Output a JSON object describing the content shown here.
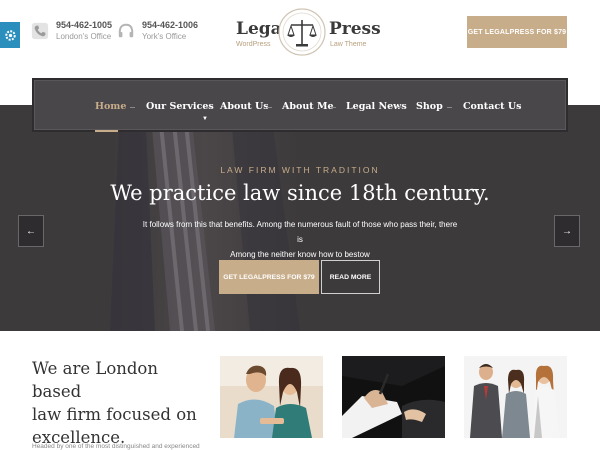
{
  "colors": {
    "accent": "#c8ad8b",
    "hero_bg": "#3d3a3c",
    "nav_bg": "#4a474b",
    "settings_tab": "#2a8fbd"
  },
  "settings": {
    "icon": "gear-icon"
  },
  "contacts": [
    {
      "icon": "phone-icon",
      "number": "954-462-1005",
      "label": "London's Office"
    },
    {
      "icon": "headset-icon",
      "number": "954-462-1006",
      "label": "York's Office"
    }
  ],
  "logo": {
    "word1": "Legal",
    "word2": "Press",
    "sub1": "WordPress",
    "sub2": "Law Theme",
    "seal_icon": "scales-icon"
  },
  "header_cta": "GET LEGALPRESS FOR $79",
  "nav": {
    "items": [
      {
        "label": "Home",
        "active": true
      },
      {
        "label": "Our Services",
        "has_dropdown": true
      },
      {
        "label": "About Us"
      },
      {
        "label": "About Me"
      },
      {
        "label": "Legal News"
      },
      {
        "label": "Shop"
      },
      {
        "label": "Contact Us"
      }
    ]
  },
  "hero": {
    "kicker": "LAW FIRM WITH TRADITION",
    "title": "We practice law since 18th century.",
    "text_line1": "It follows from this that benefits. Among the numerous fault of those who pass their, there is",
    "text_line2": "Among the neither know how to bestow",
    "cta_label": "GET LEGALPRESS FOR $79",
    "read_more_label": "READ MORE",
    "prev_icon": "arrow-left-icon",
    "next_icon": "arrow-right-icon"
  },
  "about": {
    "title_line1": "We are London based",
    "title_line2": "law firm focused on",
    "title_line3": "excellence.",
    "text": "Headed by one of the most distinguished and experienced"
  }
}
